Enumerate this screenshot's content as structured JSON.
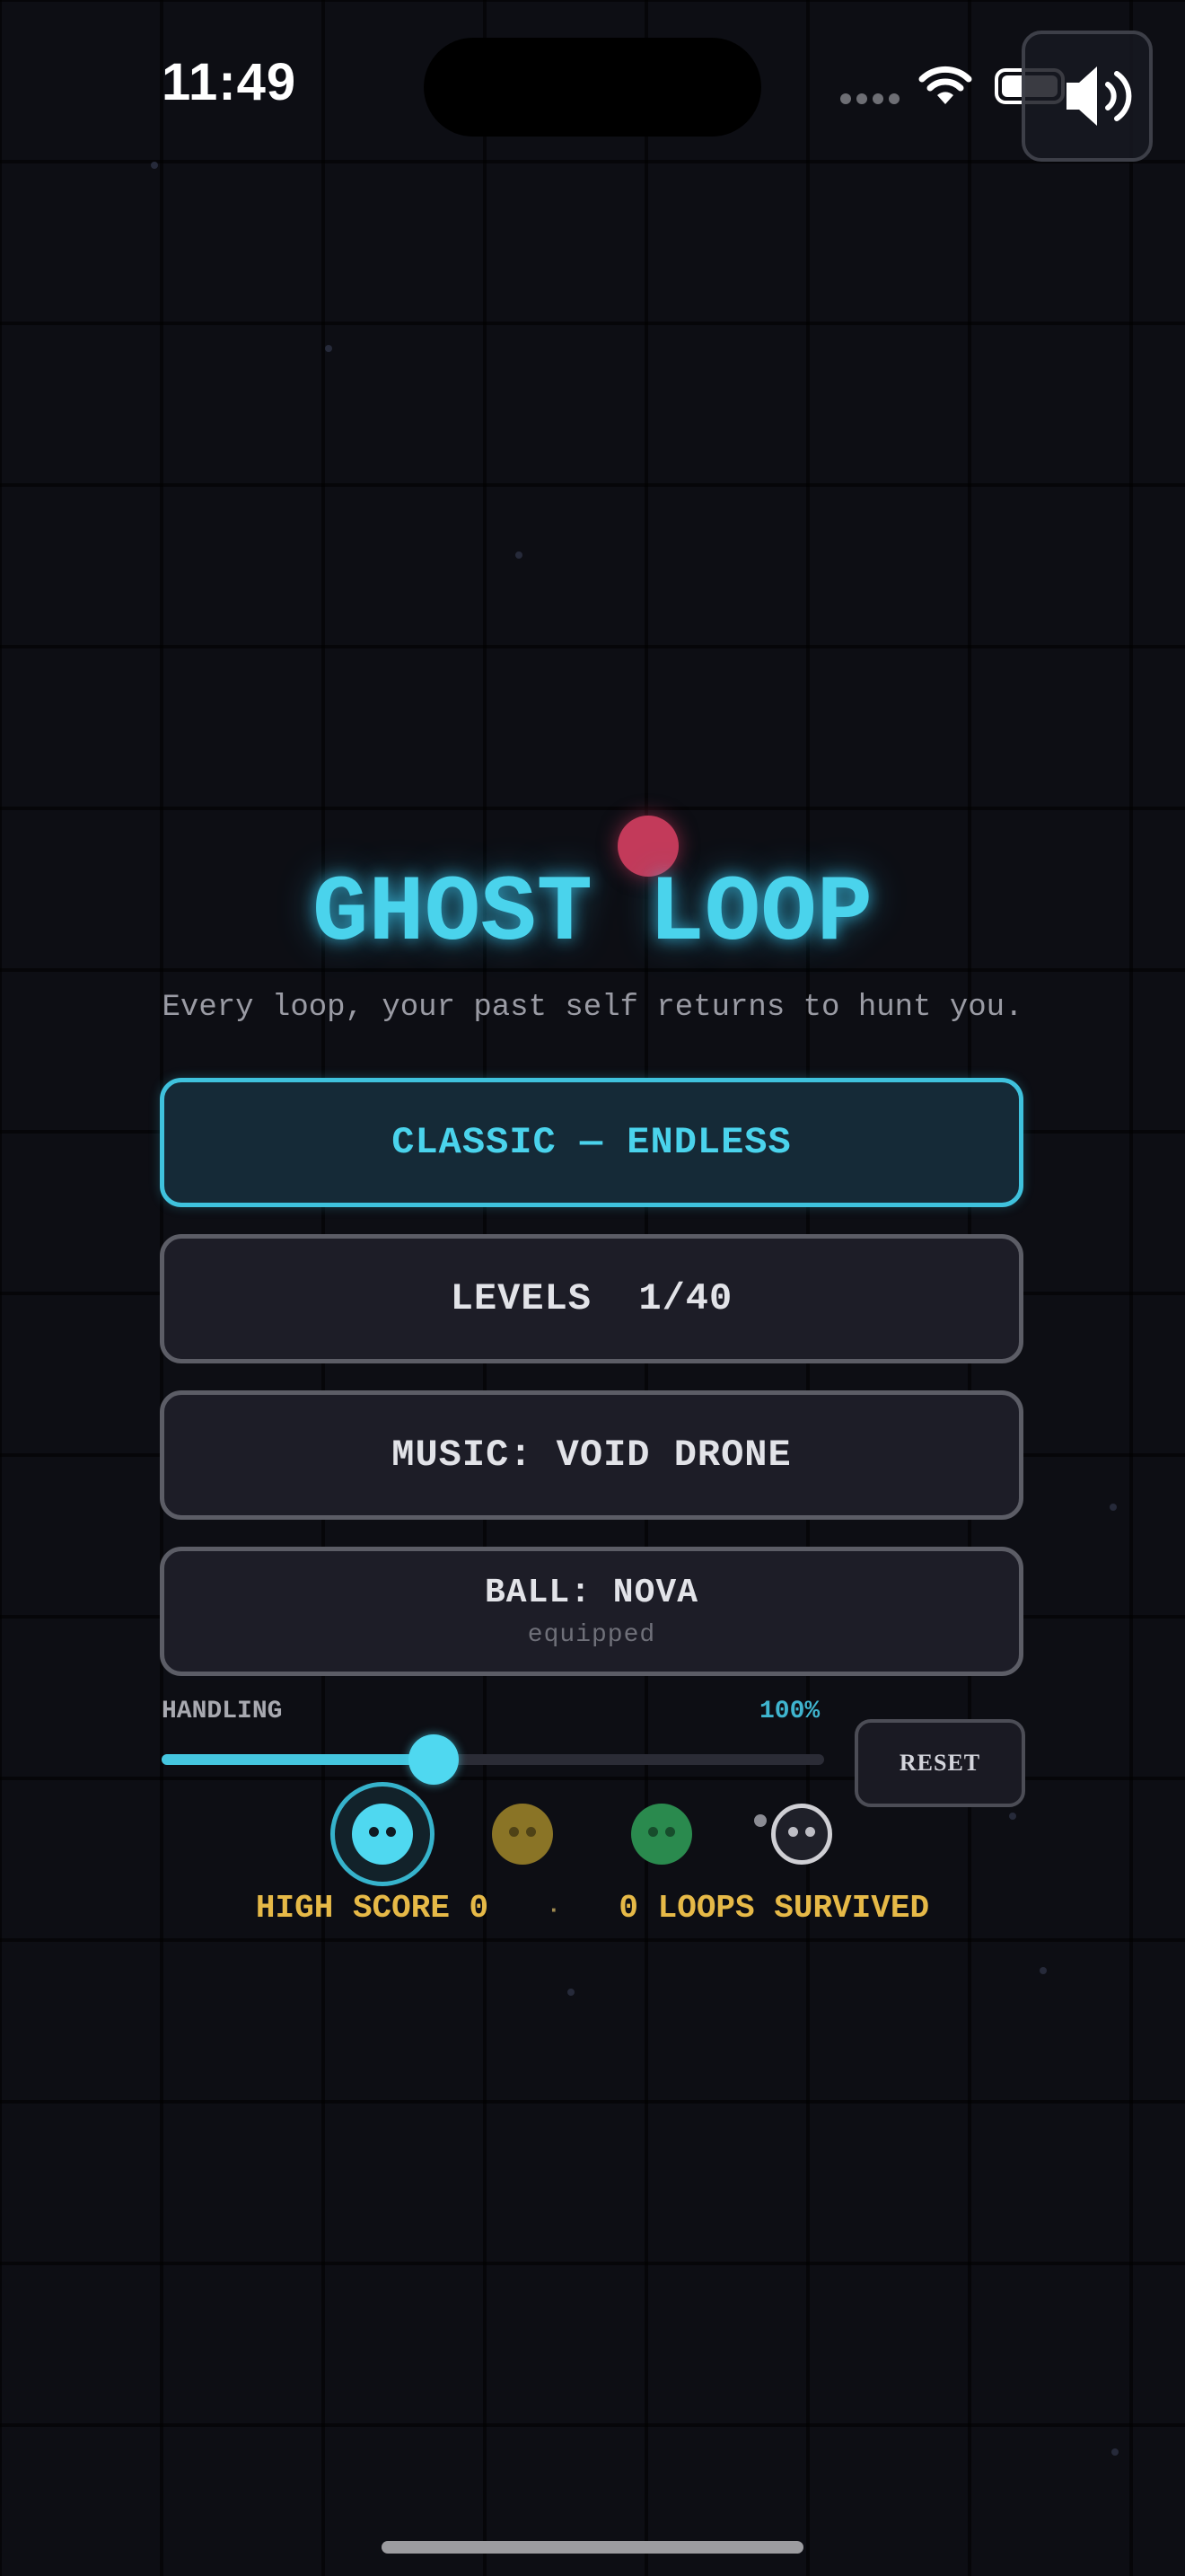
{
  "status_bar": {
    "time": "11:49"
  },
  "title": "GHOST LOOP",
  "subtitle": "Every loop, your past self returns to hunt you.",
  "menu": {
    "classic_label": "CLASSIC — ENDLESS",
    "levels_label": "LEVELS  1/40",
    "music_label": "MUSIC: VOID DRONE",
    "ball_label": "BALL: NOVA",
    "ball_status": "equipped"
  },
  "handling": {
    "label": "HANDLING",
    "value_text": "100%",
    "slider_fraction": 0.41
  },
  "reset_label": "RESET",
  "ghost_skins": [
    {
      "name": "cyan",
      "color": "#4fd8f0",
      "selected": true
    },
    {
      "name": "yellow",
      "color": "#8a7426",
      "selected": false
    },
    {
      "name": "green",
      "color": "#2a8a4e",
      "selected": false
    },
    {
      "name": "white",
      "color": "#d0d0d4",
      "selected": false
    }
  ],
  "score": {
    "high_score_text": "HIGH SCORE 0",
    "separator": "·",
    "loops_text": "0 LOOPS SURVIVED"
  },
  "colors": {
    "accent": "#4ad3ec",
    "score": "#e6b947",
    "orb": "#c33a5a",
    "background": "#0d0e14"
  },
  "icons": {
    "sound": "speaker-icon",
    "wifi": "wifi-icon",
    "battery": "battery-icon"
  }
}
